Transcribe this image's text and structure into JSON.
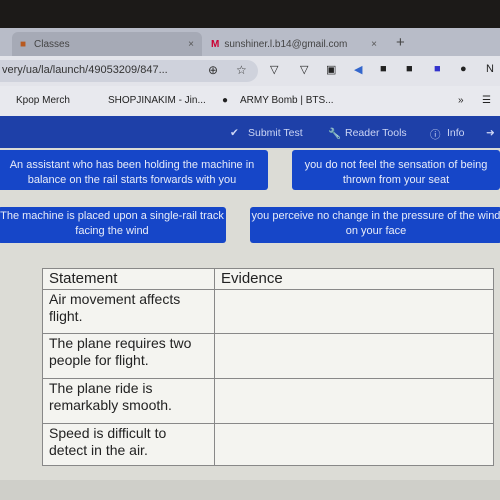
{
  "browser": {
    "tabs": [
      {
        "label": "Classes",
        "close": "×"
      },
      {
        "label": "sunshiner.l.b14@gmail.com",
        "close": "×"
      }
    ],
    "new_tab": "+",
    "url": "very/ua/la/launch/49053209/847...",
    "bookmarks": [
      "Kpop Merch",
      "SHOPJINAKIM - Jin...",
      "ARMY Bomb | BTS..."
    ],
    "more": "»"
  },
  "nav": {
    "submit": "Submit Test",
    "reader": "Reader Tools",
    "info": "Info"
  },
  "cards": [
    "An assistant who has been holding the machine in balance on the rail starts forwards with you",
    "you do not feel the sensation of being thrown from your seat",
    "The machine is placed upon a single-rail track facing the wind",
    "you perceive no change in the pressure of the wind on your face"
  ],
  "table": {
    "headers": [
      "Statement",
      "Evidence"
    ],
    "rows": [
      {
        "statement": "Air movement affects flight.",
        "evidence": ""
      },
      {
        "statement": "The plane requires two people for flight.",
        "evidence": ""
      },
      {
        "statement": "The plane ride is remarkably smooth.",
        "evidence": ""
      },
      {
        "statement": "Speed is difficult to detect in the air.",
        "evidence": ""
      }
    ]
  }
}
